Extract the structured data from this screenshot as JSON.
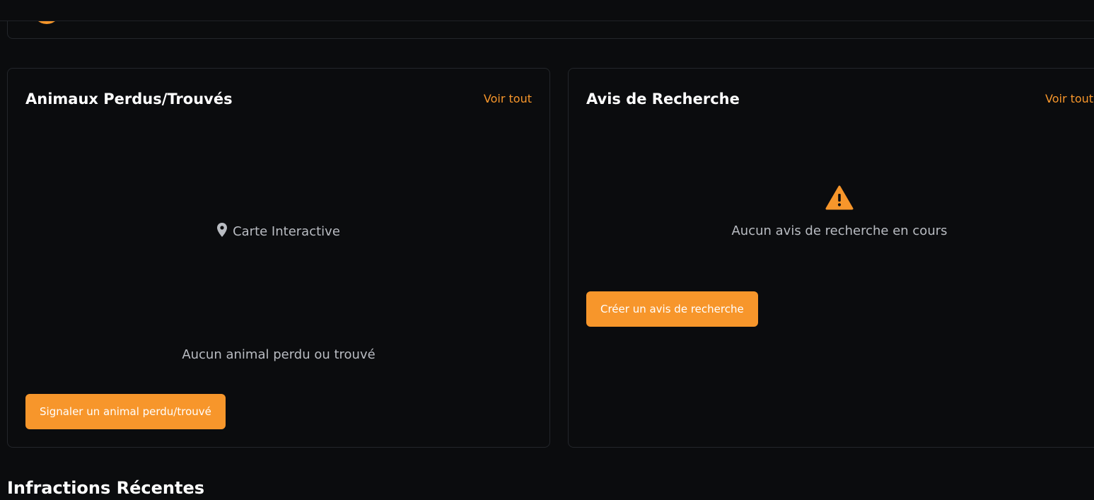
{
  "lost_found": {
    "title": "Animaux Perdus/Trouvés",
    "see_all_label": "Voir tout",
    "map_label": "Carte Interactive",
    "empty_text": "Aucun animal perdu ou trouvé",
    "report_button_label": "Signaler un animal perdu/trouvé"
  },
  "wanted": {
    "title": "Avis de Recherche",
    "see_all_label": "Voir tout",
    "empty_text": "Aucun avis de recherche en cours",
    "create_button_label": "Créer un avis de recherche"
  },
  "infractions": {
    "title": "Infractions Récentes"
  },
  "icons": {
    "map": "map-pin-icon",
    "warning": "warning-triangle-icon"
  },
  "colors": {
    "accent": "#f7962b",
    "background": "#0b0c0e",
    "border": "#23262b",
    "muted_text": "#b9bcc2"
  }
}
